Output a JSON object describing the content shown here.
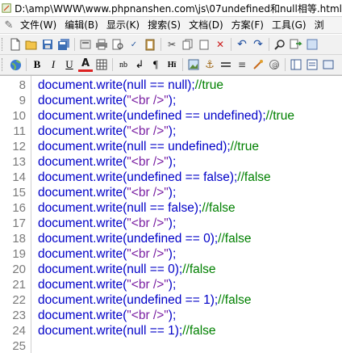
{
  "window": {
    "title": "D:\\amp\\WWW\\www.phpnanshen.com\\js\\07undefined和null相等.html"
  },
  "menu": {
    "items": [
      "文件(W)",
      "编辑(B)",
      "显示(K)",
      "搜索(S)",
      "文档(D)",
      "方案(F)",
      "工具(G)",
      "浏"
    ]
  },
  "colors": {
    "code": "#0000c8",
    "string": "#7a1fa2",
    "comment": "#008000",
    "line_number": "#7a7a7a"
  },
  "toolbar_icons": {
    "row1": [
      "new-file-icon",
      "open-folder-icon",
      "save-icon",
      "save-all-icon",
      "cut-icon",
      "print-icon",
      "print-preview-icon",
      "spellcheck-icon",
      "clipboard-icon",
      "copy-icon",
      "paste-icon",
      "delete-icon",
      "undo-icon",
      "redo-icon",
      "find-icon",
      "replace-icon"
    ],
    "row2": [
      "globe-icon",
      "bold-icon",
      "italic-icon",
      "underline-icon",
      "font-color-icon",
      "table-icon",
      "nbsp-icon",
      "br-icon",
      "paragraph-icon",
      "heading-icon",
      "image-icon",
      "anchor-icon",
      "hr-icon",
      "align-icon",
      "link-icon",
      "comment-icon",
      "frame-icon",
      "list-icon"
    ]
  },
  "editor": {
    "lines": [
      {
        "num": "8",
        "code": "document.write(null == null);",
        "string": "",
        "tail": "",
        "comment": "//true"
      },
      {
        "num": "9",
        "code": "document.write(",
        "string": "\"<br />\"",
        "tail": ");",
        "comment": ""
      },
      {
        "num": "10",
        "code": "document.write(undefined == undefined);",
        "string": "",
        "tail": "",
        "comment": "//true"
      },
      {
        "num": "11",
        "code": "document.write(",
        "string": "\"<br />\"",
        "tail": ");",
        "comment": ""
      },
      {
        "num": "12",
        "code": "document.write(null == undefined);",
        "string": "",
        "tail": "",
        "comment": "//true"
      },
      {
        "num": "13",
        "code": "document.write(",
        "string": "\"<br />\"",
        "tail": ");",
        "comment": ""
      },
      {
        "num": "14",
        "code": "document.write(undefined == false);",
        "string": "",
        "tail": "",
        "comment": "//false"
      },
      {
        "num": "15",
        "code": "document.write(",
        "string": "\"<br />\"",
        "tail": ");",
        "comment": ""
      },
      {
        "num": "16",
        "code": "document.write(null == false);",
        "string": "",
        "tail": "",
        "comment": "//false"
      },
      {
        "num": "17",
        "code": "document.write(",
        "string": "\"<br />\"",
        "tail": ");",
        "comment": ""
      },
      {
        "num": "18",
        "code": "document.write(undefined == 0);",
        "string": "",
        "tail": "",
        "comment": "//false"
      },
      {
        "num": "19",
        "code": "document.write(",
        "string": "\"<br />\"",
        "tail": ");",
        "comment": ""
      },
      {
        "num": "20",
        "code": "document.write(null == 0);",
        "string": "",
        "tail": "",
        "comment": "//false"
      },
      {
        "num": "21",
        "code": "document.write(",
        "string": "\"<br />\"",
        "tail": ");",
        "comment": ""
      },
      {
        "num": "22",
        "code": "document.write(undefined == 1);",
        "string": "",
        "tail": "",
        "comment": "//false"
      },
      {
        "num": "23",
        "code": "document.write(",
        "string": "\"<br />\"",
        "tail": ");",
        "comment": ""
      },
      {
        "num": "24",
        "code": "document.write(null == 1);",
        "string": "",
        "tail": "",
        "comment": "//false"
      },
      {
        "num": "25",
        "code": "",
        "string": "",
        "tail": "",
        "comment": ""
      }
    ]
  }
}
